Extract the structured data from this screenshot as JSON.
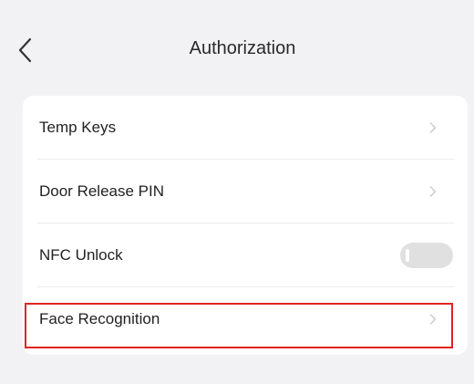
{
  "header": {
    "title": "Authorization",
    "back_icon": "chevron-left-icon"
  },
  "settings": {
    "items": [
      {
        "label": "Temp Keys",
        "type": "link",
        "icon": "chevron-right-icon"
      },
      {
        "label": "Door Release PIN",
        "type": "link",
        "icon": "chevron-right-icon"
      },
      {
        "label": "NFC Unlock",
        "type": "toggle",
        "toggle_on": false
      },
      {
        "label": "Face Recognition",
        "type": "link",
        "icon": "chevron-right-icon",
        "highlighted": true
      }
    ]
  },
  "colors": {
    "background": "#f2f2f5",
    "card": "#ffffff",
    "highlight_border": "#e02323",
    "toggle_off": "#e0e0e0",
    "chevron": "#c8c8c8"
  }
}
